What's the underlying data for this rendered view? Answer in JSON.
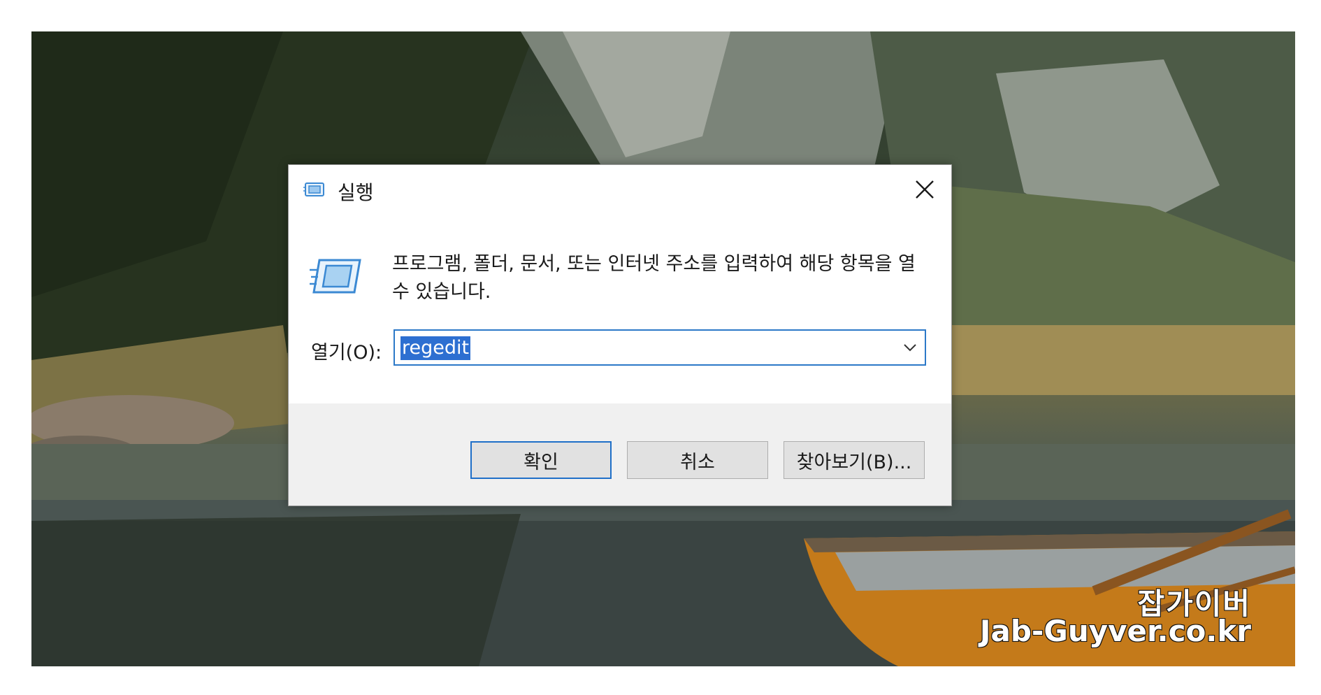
{
  "dialog": {
    "title": "실행",
    "description": "프로그램, 폴더, 문서, 또는 인터넷 주소를 입력하여 해당 항목을 열 수 있습니다.",
    "open_label": "열기(O):",
    "input_value": "regedit",
    "buttons": {
      "ok": "확인",
      "cancel": "취소",
      "browse": "찾아보기(B)..."
    }
  },
  "watermark": {
    "name": "잡가이버",
    "url": "Jab-Guyver.co.kr"
  },
  "icons": {
    "title": "run-icon",
    "close": "close-icon",
    "dropdown": "chevron-down-icon"
  },
  "colors": {
    "accent": "#2c79c8",
    "selection": "#2d6fd1",
    "button_bar": "#f0f0f0"
  }
}
